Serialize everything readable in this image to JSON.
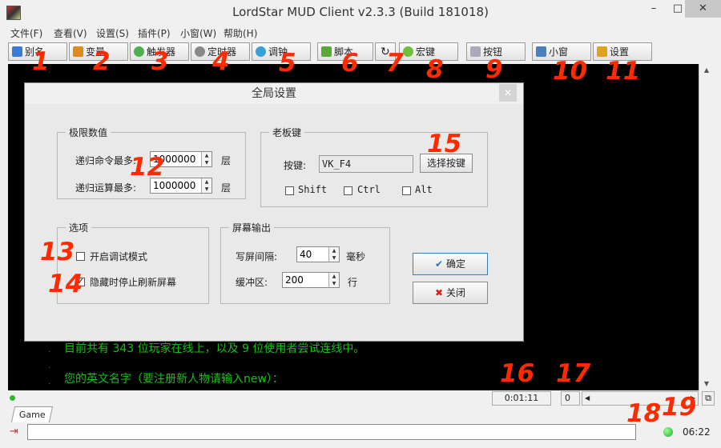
{
  "window": {
    "title": "LordStar MUD Client v2.3.3 (Build 181018)",
    "minimize": "–",
    "maximize": "□",
    "close": "✕"
  },
  "menu": [
    "文件(F)",
    "查看(V)",
    "设置(S)",
    "插件(P)",
    "小窗(W)",
    "帮助(H)"
  ],
  "toolbar": {
    "alias": "别名",
    "variable": "变量",
    "trigger": "触发器",
    "timer": "定时器",
    "hook": "调钟",
    "script": "脚本",
    "hotkey": "宏键",
    "button": "按钮",
    "miniwin": "小窗",
    "settings": "设置"
  },
  "terminal": {
    "lines": [
      "目前共有 343 位玩家在线上，以及 9 位使用者尝试连线中。",
      "您的英文名字（要注册新人物请输入new）："
    ]
  },
  "status": {
    "elapsed": "0:01:11",
    "counter": "0",
    "clock": "06:22"
  },
  "tabs": {
    "game": "Game"
  },
  "dialog": {
    "title": "全局设置",
    "limits": {
      "title": "极限数值",
      "cmd_label": "递归命令最多:",
      "cmd_value": "1000000",
      "cmd_unit": "层",
      "calc_label": "递归运算最多:",
      "calc_value": "1000000",
      "calc_unit": "层"
    },
    "bosskey": {
      "title": "老板键",
      "key_label": "按键:",
      "key_value": "VK_F4",
      "choose": "选择按键",
      "shift": "Shift",
      "ctrl": "Ctrl",
      "alt": "Alt"
    },
    "options": {
      "title": "选项",
      "debug": "开启调试模式",
      "debug_checked": false,
      "hide_refresh": "隐藏时停止刷新屏幕",
      "hide_refresh_checked": true
    },
    "screen": {
      "title": "屏幕输出",
      "interval_label": "写屏间隔:",
      "interval_value": "40",
      "interval_unit": "毫秒",
      "buffer_label": "缓冲区:",
      "buffer_value": "200",
      "buffer_unit": "行"
    },
    "ok": "确定",
    "close": "关闭"
  },
  "annotations": [
    "1",
    "2",
    "3",
    "4",
    "5",
    "6",
    "7",
    "8",
    "9",
    "10",
    "11",
    "12",
    "13",
    "14",
    "15",
    "16",
    "17",
    "18",
    "19"
  ],
  "colors": {
    "terminal_bg": "#000000",
    "terminal_text": "#18c018",
    "annotation": "#ff2a00"
  }
}
